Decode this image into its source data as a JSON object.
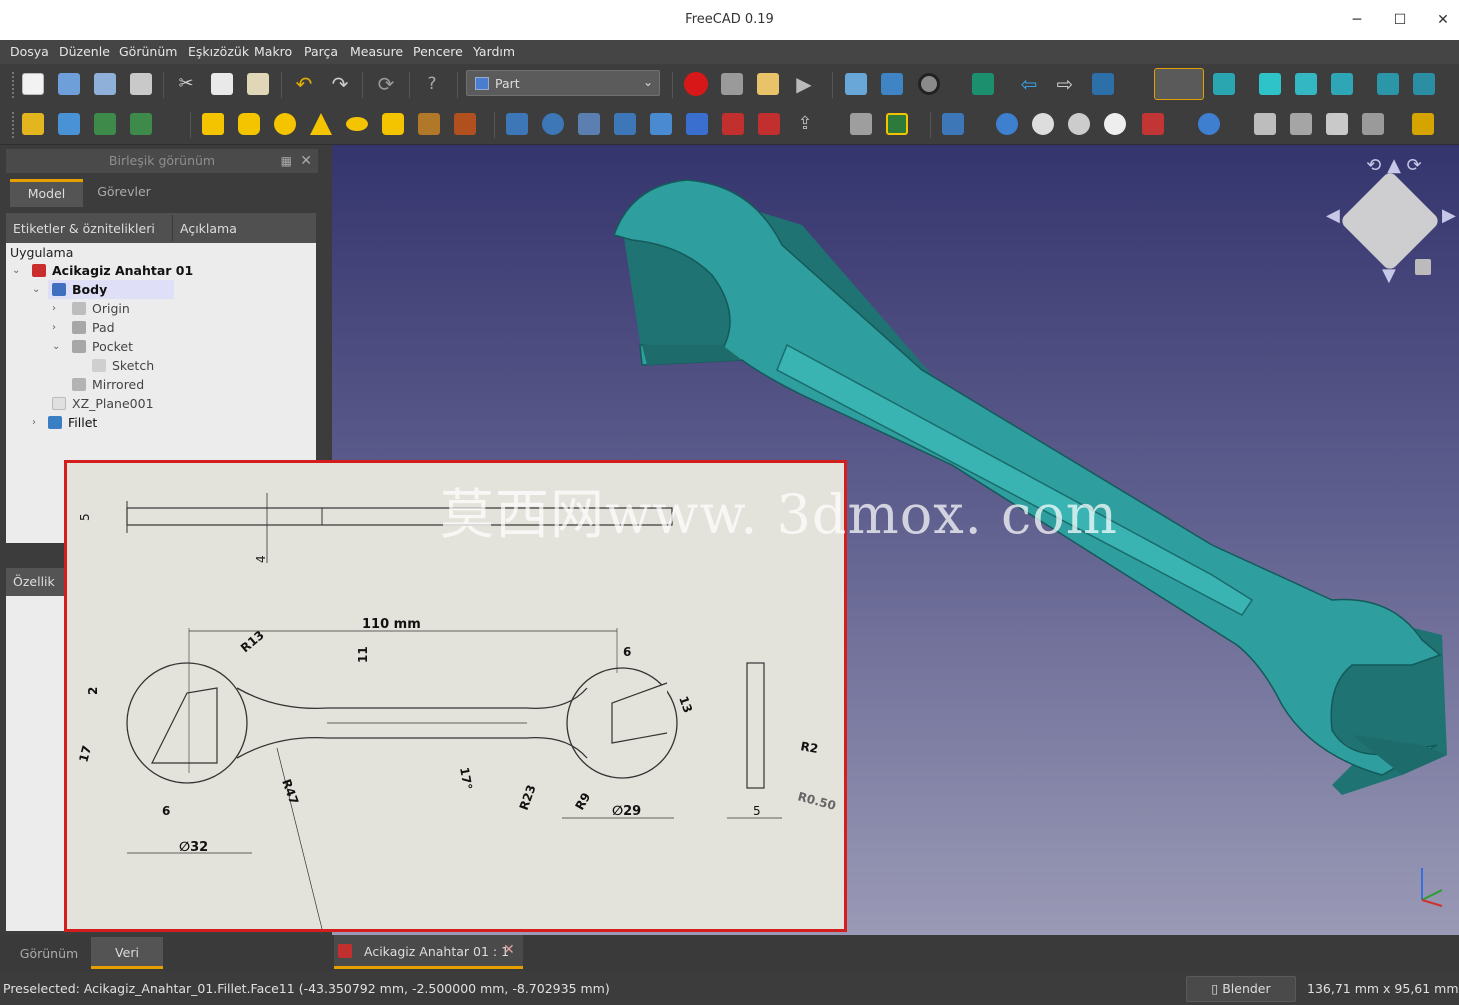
{
  "window": {
    "title": "FreeCAD 0.19",
    "minimize": "─",
    "maximize": "☐",
    "close": "✕"
  },
  "menu": [
    "Dosya",
    "Düzenle",
    "Görünüm",
    "Eşkızözük",
    "Makro",
    "Parça",
    "Measure",
    "Pencere",
    "Yardım"
  ],
  "workbench": {
    "selected": "Part"
  },
  "combo_view": {
    "title": "Birleşik görünüm",
    "tabs": [
      "Model",
      "Görevler"
    ],
    "tree_headers": [
      "Etiketler & öznitelikleri",
      "Açıklama"
    ],
    "root": "Uygulama",
    "tree": [
      {
        "label": "Acikagiz Anahtar 01",
        "bold": true
      },
      {
        "label": "Body",
        "bold": true
      },
      {
        "label": "Origin"
      },
      {
        "label": "Pad"
      },
      {
        "label": "Pocket"
      },
      {
        "label": "Sketch"
      },
      {
        "label": "Mirrored"
      },
      {
        "label": "XZ_Plane001"
      },
      {
        "label": "Fillet"
      }
    ],
    "properties_label": "Özellik"
  },
  "bottom_tabs": [
    "Görünüm",
    "Veri"
  ],
  "document_tab": "Acikagiz Anahtar 01 : 1",
  "drawing": {
    "watermark": "莫西网www. 3dmox. com",
    "dims": {
      "length": "110 mm",
      "d32": "∅32",
      "d29": "∅29",
      "r13": "R13",
      "r47": "R47",
      "r23": "R23",
      "r9": "R9",
      "r2": "R2",
      "r05": "R0.50",
      "t5": "5",
      "t5b": "5",
      "w4": "4",
      "w2": "2",
      "w11": "11",
      "w6a": "6",
      "w6b": "6",
      "w13": "13",
      "a17": "17",
      "a17b": "17°"
    }
  },
  "status": {
    "preselected": "Preselected: Acikagiz_Anahtar_01.Fillet.Face11 (-43.350792 mm, -2.500000 mm, -8.702935 mm)",
    "navigation": "Blender",
    "dimensions": "136,71 mm x 95,61 mm"
  },
  "colors": {
    "accent": "#e5a000",
    "model": "#2f9e9e",
    "frame": "#d41d1d"
  }
}
